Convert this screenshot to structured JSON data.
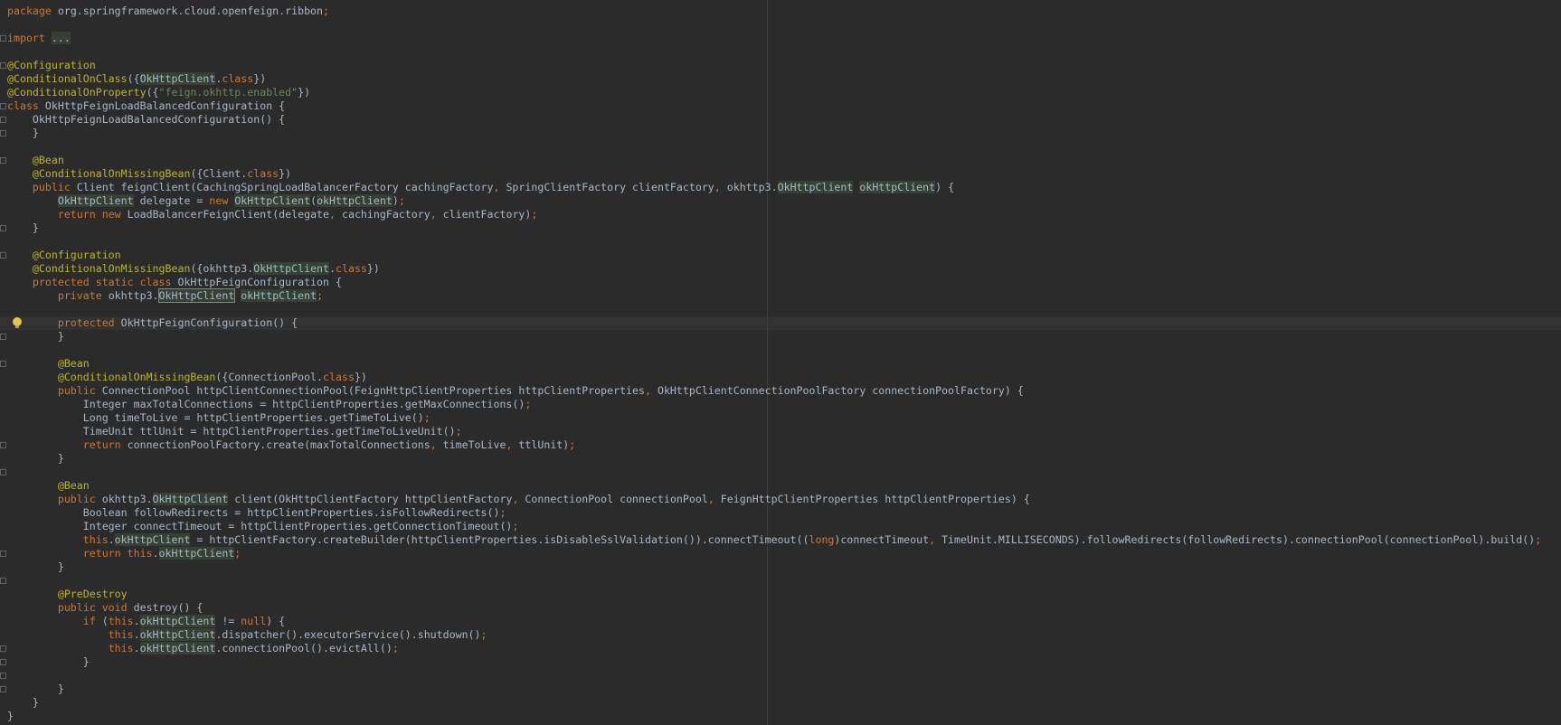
{
  "editor": {
    "lines": [
      [
        {
          "t": "package",
          "c": "kw"
        },
        {
          "t": " org.springframework.cloud.openfeign.ribbon"
        },
        {
          "t": ";",
          "c": "kw"
        }
      ],
      [],
      [
        {
          "t": "import",
          "c": "kw"
        },
        {
          "t": " "
        },
        {
          "t": "...",
          "c": "hl"
        }
      ],
      [],
      [
        {
          "t": "@Configuration",
          "c": "an"
        }
      ],
      [
        {
          "t": "@ConditionalOnClass",
          "c": "an"
        },
        {
          "t": "({"
        },
        {
          "t": "OkHttpClient",
          "c": "hl"
        },
        {
          "t": "."
        },
        {
          "t": "class",
          "c": "kw"
        },
        {
          "t": "})"
        }
      ],
      [
        {
          "t": "@ConditionalOnProperty",
          "c": "an"
        },
        {
          "t": "({"
        },
        {
          "t": "\"feign.okhttp.enabled\"",
          "c": "st"
        },
        {
          "t": "})"
        }
      ],
      [
        {
          "t": "class",
          "c": "kw"
        },
        {
          "t": " OkHttpFeignLoadBalancedConfiguration {"
        }
      ],
      [
        {
          "t": "    OkHttpFeignLoadBalancedConfiguration() {"
        }
      ],
      [
        {
          "t": "    }"
        }
      ],
      [],
      [
        {
          "t": "    "
        },
        {
          "t": "@Bean",
          "c": "an"
        }
      ],
      [
        {
          "t": "    "
        },
        {
          "t": "@ConditionalOnMissingBean",
          "c": "an"
        },
        {
          "t": "({Client."
        },
        {
          "t": "class",
          "c": "kw"
        },
        {
          "t": "})"
        }
      ],
      [
        {
          "t": "    "
        },
        {
          "t": "public",
          "c": "kw"
        },
        {
          "t": " Client feignClient(CachingSpringLoadBalancerFactory cachingFactory"
        },
        {
          "t": ",",
          "c": "kw"
        },
        {
          "t": " SpringClientFactory clientFactory"
        },
        {
          "t": ",",
          "c": "kw"
        },
        {
          "t": " okhttp3."
        },
        {
          "t": "OkHttpClient",
          "c": "hl"
        },
        {
          "t": " "
        },
        {
          "t": "okHttpClient",
          "c": "hl"
        },
        {
          "t": ") {"
        }
      ],
      [
        {
          "t": "        "
        },
        {
          "t": "OkHttpClient",
          "c": "hl"
        },
        {
          "t": " delegate = "
        },
        {
          "t": "new",
          "c": "kw"
        },
        {
          "t": " "
        },
        {
          "t": "OkHttpClient",
          "c": "hl"
        },
        {
          "t": "("
        },
        {
          "t": "okHttpClient",
          "c": "hl"
        },
        {
          "t": ")"
        },
        {
          "t": ";",
          "c": "kw"
        }
      ],
      [
        {
          "t": "        "
        },
        {
          "t": "return",
          "c": "kw"
        },
        {
          "t": " "
        },
        {
          "t": "new",
          "c": "kw"
        },
        {
          "t": " LoadBalancerFeignClient(delegate"
        },
        {
          "t": ",",
          "c": "kw"
        },
        {
          "t": " cachingFactory"
        },
        {
          "t": ",",
          "c": "kw"
        },
        {
          "t": " clientFactory)"
        },
        {
          "t": ";",
          "c": "kw"
        }
      ],
      [
        {
          "t": "    }"
        }
      ],
      [],
      [
        {
          "t": "    "
        },
        {
          "t": "@Configuration",
          "c": "an"
        }
      ],
      [
        {
          "t": "    "
        },
        {
          "t": "@ConditionalOnMissingBean",
          "c": "an"
        },
        {
          "t": "({okhttp3."
        },
        {
          "t": "OkHttpClient",
          "c": "hl"
        },
        {
          "t": "."
        },
        {
          "t": "class",
          "c": "kw"
        },
        {
          "t": "})"
        }
      ],
      [
        {
          "t": "    "
        },
        {
          "t": "protected static class",
          "c": "kw"
        },
        {
          "t": " OkHttpFeignConfiguration {"
        }
      ],
      [
        {
          "t": "        "
        },
        {
          "t": "private",
          "c": "kw"
        },
        {
          "t": " okhttp3."
        },
        {
          "t": "OkHttpClient",
          "c": "hlbox"
        },
        {
          "t": " "
        },
        {
          "t": "okHttpClient",
          "c": "hl"
        },
        {
          "t": ";",
          "c": "kw"
        }
      ],
      [],
      [
        {
          "t": "        "
        },
        {
          "t": "protected",
          "c": "kw"
        },
        {
          "t": " OkHttpFeignConfiguration() {"
        }
      ],
      [
        {
          "t": "        }"
        }
      ],
      [],
      [
        {
          "t": "        "
        },
        {
          "t": "@Bean",
          "c": "an"
        }
      ],
      [
        {
          "t": "        "
        },
        {
          "t": "@ConditionalOnMissingBean",
          "c": "an"
        },
        {
          "t": "({ConnectionPool."
        },
        {
          "t": "class",
          "c": "kw"
        },
        {
          "t": "})"
        }
      ],
      [
        {
          "t": "        "
        },
        {
          "t": "public",
          "c": "kw"
        },
        {
          "t": " ConnectionPool httpClientConnectionPool(FeignHttpClientProperties httpClientProperties"
        },
        {
          "t": ",",
          "c": "kw"
        },
        {
          "t": " OkHttpClientConnectionPoolFactory connectionPoolFactory) {"
        }
      ],
      [
        {
          "t": "            Integer maxTotalConnections = httpClientProperties.getMaxConnections()"
        },
        {
          "t": ";",
          "c": "kw"
        }
      ],
      [
        {
          "t": "            Long timeToLive = httpClientProperties.getTimeToLive()"
        },
        {
          "t": ";",
          "c": "kw"
        }
      ],
      [
        {
          "t": "            TimeUnit ttlUnit = httpClientProperties.getTimeToLiveUnit()"
        },
        {
          "t": ";",
          "c": "kw"
        }
      ],
      [
        {
          "t": "            "
        },
        {
          "t": "return",
          "c": "kw"
        },
        {
          "t": " connectionPoolFactory.create(maxTotalConnections"
        },
        {
          "t": ",",
          "c": "kw"
        },
        {
          "t": " timeToLive"
        },
        {
          "t": ",",
          "c": "kw"
        },
        {
          "t": " ttlUnit)"
        },
        {
          "t": ";",
          "c": "kw"
        }
      ],
      [
        {
          "t": "        }"
        }
      ],
      [],
      [
        {
          "t": "        "
        },
        {
          "t": "@Bean",
          "c": "an"
        }
      ],
      [
        {
          "t": "        "
        },
        {
          "t": "public",
          "c": "kw"
        },
        {
          "t": " okhttp3."
        },
        {
          "t": "OkHttpClient",
          "c": "hl"
        },
        {
          "t": " client(OkHttpClientFactory httpClientFactory"
        },
        {
          "t": ",",
          "c": "kw"
        },
        {
          "t": " ConnectionPool connectionPool"
        },
        {
          "t": ",",
          "c": "kw"
        },
        {
          "t": " FeignHttpClientProperties httpClientProperties) {"
        }
      ],
      [
        {
          "t": "            Boolean followRedirects = httpClientProperties.isFollowRedirects()"
        },
        {
          "t": ";",
          "c": "kw"
        }
      ],
      [
        {
          "t": "            Integer connectTimeout = httpClientProperties.getConnectionTimeout()"
        },
        {
          "t": ";",
          "c": "kw"
        }
      ],
      [
        {
          "t": "            "
        },
        {
          "t": "this",
          "c": "kw"
        },
        {
          "t": "."
        },
        {
          "t": "okHttpClient",
          "c": "hl"
        },
        {
          "t": " = httpClientFactory.createBuilder(httpClientProperties.isDisableSslValidation()).connectTimeout(("
        },
        {
          "t": "long",
          "c": "kw"
        },
        {
          "t": ")connectTimeout"
        },
        {
          "t": ",",
          "c": "kw"
        },
        {
          "t": " TimeUnit.MILLISECONDS).followRedirects(followRedirects).connectionPool(connectionPool).build()"
        },
        {
          "t": ";",
          "c": "kw"
        }
      ],
      [
        {
          "t": "            "
        },
        {
          "t": "return this",
          "c": "kw"
        },
        {
          "t": "."
        },
        {
          "t": "okHttpClient",
          "c": "hl"
        },
        {
          "t": ";",
          "c": "kw"
        }
      ],
      [
        {
          "t": "        }"
        }
      ],
      [],
      [
        {
          "t": "        "
        },
        {
          "t": "@PreDestroy",
          "c": "an"
        }
      ],
      [
        {
          "t": "        "
        },
        {
          "t": "public void",
          "c": "kw"
        },
        {
          "t": " destroy() {"
        }
      ],
      [
        {
          "t": "            "
        },
        {
          "t": "if",
          "c": "kw"
        },
        {
          "t": " ("
        },
        {
          "t": "this",
          "c": "kw"
        },
        {
          "t": "."
        },
        {
          "t": "okHttpClient",
          "c": "hl"
        },
        {
          "t": " != "
        },
        {
          "t": "null",
          "c": "kw"
        },
        {
          "t": ") {"
        }
      ],
      [
        {
          "t": "                "
        },
        {
          "t": "this",
          "c": "kw"
        },
        {
          "t": "."
        },
        {
          "t": "okHttpClient",
          "c": "hl"
        },
        {
          "t": ".dispatcher().executorService().shutdown()"
        },
        {
          "t": ";",
          "c": "kw"
        }
      ],
      [
        {
          "t": "                "
        },
        {
          "t": "this",
          "c": "kw"
        },
        {
          "t": "."
        },
        {
          "t": "okHttpClient",
          "c": "hl"
        },
        {
          "t": ".connectionPool().evictAll()"
        },
        {
          "t": ";",
          "c": "kw"
        }
      ],
      [
        {
          "t": "            }"
        }
      ],
      [],
      [
        {
          "t": "        }"
        }
      ],
      [
        {
          "t": "    }"
        }
      ],
      [
        {
          "t": "}"
        }
      ]
    ],
    "caret_line": 23,
    "intention_icon": "lightbulb-icon",
    "fold_icon": "fold-marker-icon",
    "fold_lines": [
      2,
      4,
      7,
      8,
      9,
      11,
      16,
      18,
      23,
      24,
      26,
      32,
      34,
      40,
      42,
      47,
      48,
      49,
      50
    ]
  }
}
